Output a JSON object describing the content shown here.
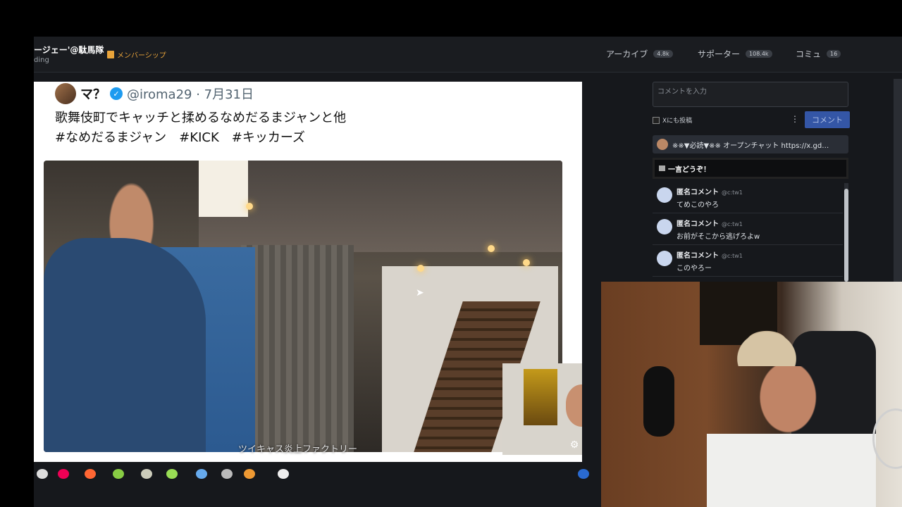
{
  "header": {
    "channel_name": "ージェー'@駄馬隊",
    "channel_sub": "ding",
    "membership_label": "メンバーシップ",
    "tabs": [
      {
        "label": "アーカイブ",
        "badge": "4.8k"
      },
      {
        "label": "サポーター",
        "badge": "108.4k"
      },
      {
        "label": "コミュ",
        "badge": "16"
      }
    ]
  },
  "video": {
    "tweet_name": "マ？",
    "tweet_handle_date": "@iroma29 · 7月31日",
    "tweet_line1": "歌舞伎町でキャッチと揉めるなめだるまジャンと他",
    "tweet_line2": "#なめだるまジャン　#KICK　#キッカーズ",
    "caption": "ツイキャス炎上ファクトリー"
  },
  "chat": {
    "input_placeholder": "コメントを入力",
    "post_to_x_label": "Xにも投稿",
    "more_label": "⋮",
    "submit_label": "コメント",
    "announcement": "※※▼必読▼※※ オープンチャット https://x.gd…",
    "hitokoto_label": "一言どうぞ！",
    "comments": [
      {
        "name": "匿名コメント",
        "id": "@c:tw1",
        "text": "てめこのやろ"
      },
      {
        "name": "匿名コメント",
        "id": "@c:tw1",
        "text": "お前がそこから逃げろよw"
      },
      {
        "name": "匿名コメント",
        "id": "@c:tw1",
        "text": "このやろー"
      }
    ]
  },
  "colors": {
    "accent_orange": "#e8a33a",
    "button_blue": "#3456a6",
    "verified_blue": "#1d9bf0"
  }
}
